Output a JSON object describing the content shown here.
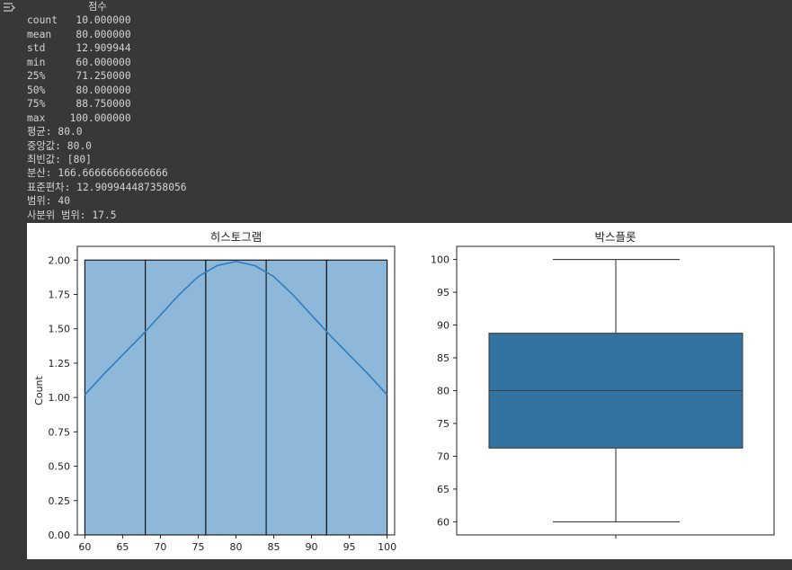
{
  "output_text": "          점수\ncount   10.000000\nmean    80.000000\nstd     12.909944\nmin     60.000000\n25%     71.250000\n50%     80.000000\n75%     88.750000\nmax    100.000000\n평균: 80.0\n중앙값: 80.0\n최빈값: [80]\n분산: 166.66666666666666\n표준편차: 12.909944487358056\n범위: 40\n사분위 범위: 17.5",
  "icons": {
    "output": "output-toggle-icon"
  },
  "colors": {
    "background": "#383838",
    "hist_fill": "#8db8da",
    "kde_line": "#2f7ebc",
    "box_fill": "#3274a1"
  },
  "chart_data": [
    {
      "type": "bar",
      "title": "히스토그램",
      "xlabel": "",
      "ylabel": "Count",
      "bins": [
        [
          60,
          68
        ],
        [
          68,
          76
        ],
        [
          76,
          84
        ],
        [
          84,
          92
        ],
        [
          92,
          100
        ]
      ],
      "values": [
        2,
        2,
        2,
        2,
        2
      ],
      "kde": {
        "x": [
          60,
          62.5,
          65,
          67.5,
          70,
          72.5,
          75,
          77.5,
          80,
          82.5,
          85,
          87.5,
          90,
          92.5,
          95,
          97.5,
          100
        ],
        "y": [
          1.02,
          1.17,
          1.31,
          1.45,
          1.6,
          1.75,
          1.88,
          1.96,
          1.99,
          1.96,
          1.88,
          1.75,
          1.6,
          1.45,
          1.31,
          1.17,
          1.02
        ]
      },
      "xlim": [
        59,
        101
      ],
      "ylim": [
        0,
        2.1
      ],
      "xticks": [
        "60",
        "65",
        "70",
        "75",
        "80",
        "85",
        "90",
        "95",
        "100"
      ],
      "yticks": [
        "0.00",
        "0.25",
        "0.50",
        "0.75",
        "1.00",
        "1.25",
        "1.50",
        "1.75",
        "2.00"
      ]
    },
    {
      "type": "box",
      "title": "박스플롯",
      "box": {
        "min": 60,
        "q1": 71.25,
        "median": 80,
        "q3": 88.75,
        "max": 100
      },
      "ylim": [
        58,
        102
      ],
      "yticks": [
        "60",
        "65",
        "70",
        "75",
        "80",
        "85",
        "90",
        "95",
        "100"
      ]
    }
  ]
}
